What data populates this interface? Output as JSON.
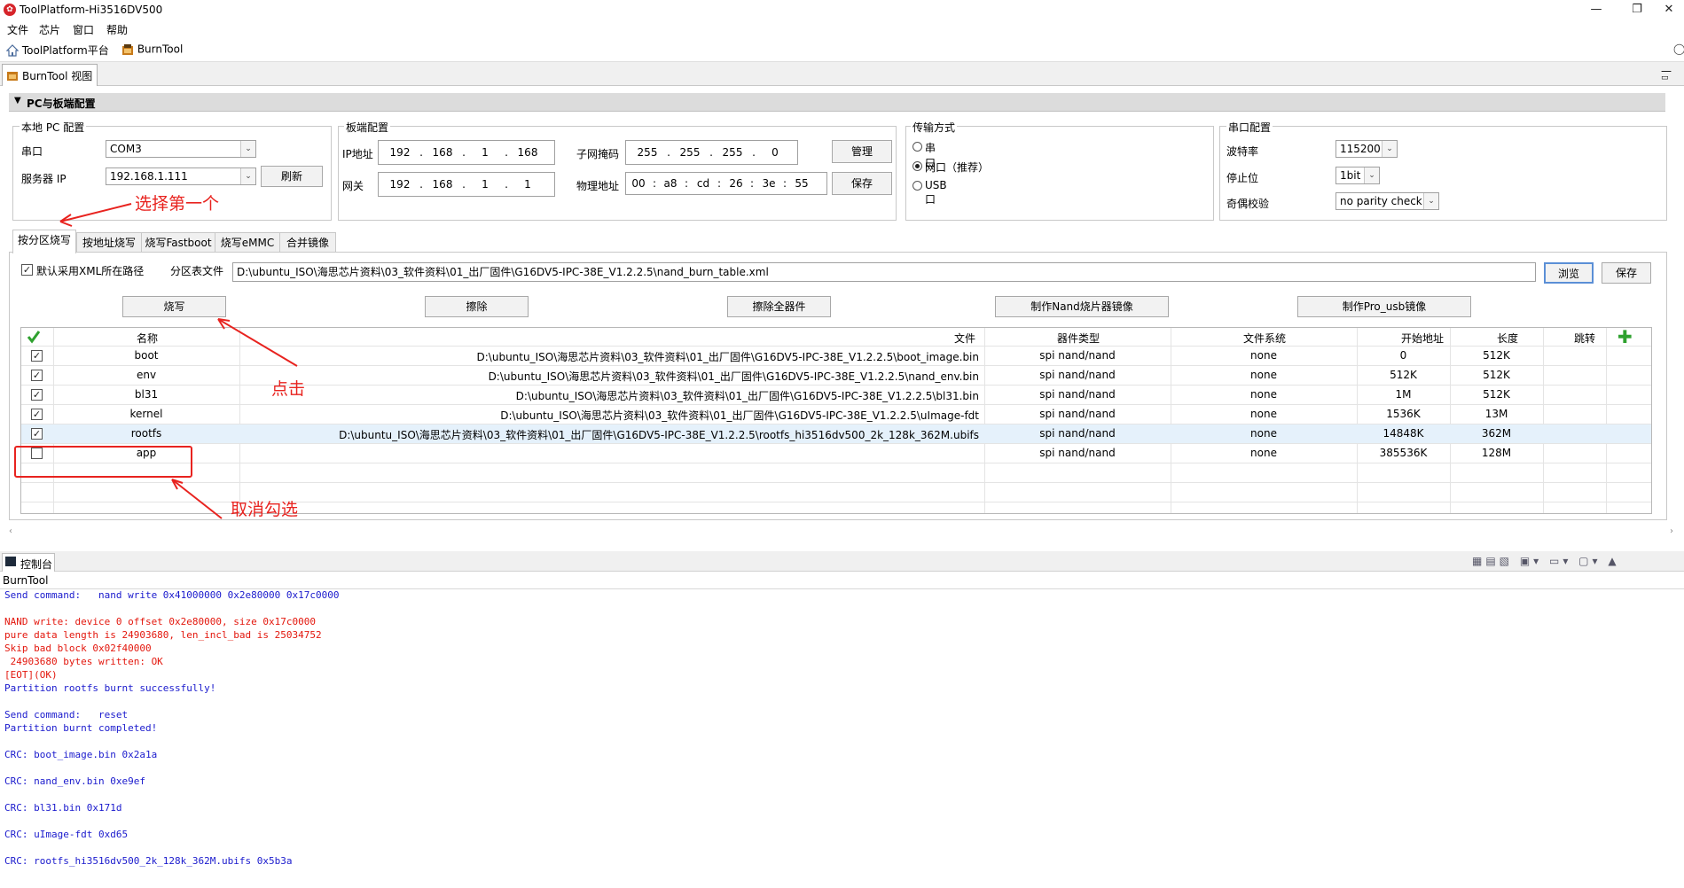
{
  "window": {
    "title": "ToolPlatform-Hi3516DV500",
    "minimize": "—",
    "restore": "❐",
    "close": "✕"
  },
  "menu": [
    "文件",
    "芯片",
    "窗口",
    "帮助"
  ],
  "toolbar": {
    "item1": "ToolPlatform平台",
    "item2": "BurnTool"
  },
  "view_tab": "BurnTool 视图",
  "section_title": "PC与板端配置",
  "local_pc": {
    "title": "本地 PC 配置",
    "port_label": "串口",
    "port_value": "COM3",
    "server_ip_label": "服务器 IP",
    "server_ip_value": "192.168.1.111",
    "refresh_btn": "刷新"
  },
  "board": {
    "title": "板端配置",
    "ip_label": "IP地址",
    "ip": [
      "192",
      "168",
      "1",
      "168"
    ],
    "gateway_label": "网关",
    "gateway": [
      "192",
      "168",
      "1",
      "1"
    ],
    "mask_label": "子网掩码",
    "mask": [
      "255",
      "255",
      "255",
      "0"
    ],
    "mac_label": "物理地址",
    "mac": [
      "00",
      "a8",
      "cd",
      "26",
      "3e",
      "55"
    ],
    "manage_btn": "管理",
    "save_btn": "保存"
  },
  "transfer": {
    "title": "传输方式",
    "opt1": "串口",
    "opt2": "网口（推荐）",
    "opt3": "USB口"
  },
  "serial": {
    "title": "串口配置",
    "baud_label": "波特率",
    "baud_value": "115200",
    "stop_label": "停止位",
    "stop_value": "1bit",
    "parity_label": "奇偶校验",
    "parity_value": "no parity check"
  },
  "tabs": [
    "按分区烧写",
    "按地址烧写",
    "烧写Fastboot",
    "烧写eMMC",
    "合并镜像"
  ],
  "partition": {
    "xml_checkbox_label": "默认采用XML所在路径",
    "table_file_label": "分区表文件",
    "table_file_path": "D:\\ubuntu_ISO\\海思芯片资料\\03_软件资料\\01_出厂固件\\G16DV5-IPC-38E_V1.2.2.5\\nand_burn_table.xml",
    "browse_btn": "浏览",
    "save_btn": "保存",
    "actions": [
      "烧写",
      "擦除",
      "擦除全器件",
      "制作Nand烧片器镜像",
      "制作Pro_usb镜像"
    ]
  },
  "table": {
    "headers": [
      "名称",
      "文件",
      "器件类型",
      "文件系统",
      "开始地址",
      "长度",
      "跳转"
    ],
    "rows": [
      {
        "checked": true,
        "name": "boot",
        "file": "D:\\ubuntu_ISO\\海思芯片资料\\03_软件资料\\01_出厂固件\\G16DV5-IPC-38E_V1.2.2.5\\boot_image.bin",
        "device": "spi nand/nand",
        "fs": "none",
        "start": "0",
        "length": "512K"
      },
      {
        "checked": true,
        "name": "env",
        "file": "D:\\ubuntu_ISO\\海思芯片资料\\03_软件资料\\01_出厂固件\\G16DV5-IPC-38E_V1.2.2.5\\nand_env.bin",
        "device": "spi nand/nand",
        "fs": "none",
        "start": "512K",
        "length": "512K"
      },
      {
        "checked": true,
        "name": "bl31",
        "file": "D:\\ubuntu_ISO\\海思芯片资料\\03_软件资料\\01_出厂固件\\G16DV5-IPC-38E_V1.2.2.5\\bl31.bin",
        "device": "spi nand/nand",
        "fs": "none",
        "start": "1M",
        "length": "512K"
      },
      {
        "checked": true,
        "name": "kernel",
        "file": "D:\\ubuntu_ISO\\海思芯片资料\\03_软件资料\\01_出厂固件\\G16DV5-IPC-38E_V1.2.2.5\\uImage-fdt",
        "device": "spi nand/nand",
        "fs": "none",
        "start": "1536K",
        "length": "13M"
      },
      {
        "checked": true,
        "name": "rootfs",
        "file": "D:\\ubuntu_ISO\\海思芯片资料\\03_软件资料\\01_出厂固件\\G16DV5-IPC-38E_V1.2.2.5\\rootfs_hi3516dv500_2k_128k_362M.ubifs",
        "device": "spi nand/nand",
        "fs": "none",
        "start": "14848K",
        "length": "362M"
      },
      {
        "checked": false,
        "name": "app",
        "file": "",
        "device": "spi nand/nand",
        "fs": "none",
        "start": "385536K",
        "length": "128M"
      }
    ]
  },
  "annotations": {
    "choose_first": "选择第一个",
    "click": "点击",
    "uncheck": "取消勾选",
    "color": "#e8231f"
  },
  "console": {
    "tab": "控制台",
    "name": "BurnTool",
    "lines": [
      {
        "c": "#1a1acd",
        "t": "Send command:   nand write 0x41000000 0x2e80000 0x17c0000"
      },
      {
        "c": "#1a1acd",
        "t": ""
      },
      {
        "c": "#e3170d",
        "t": "NAND write: device 0 offset 0x2e80000, size 0x17c0000"
      },
      {
        "c": "#e3170d",
        "t": "pure data length is 24903680, len_incl_bad is 25034752"
      },
      {
        "c": "#e3170d",
        "t": "Skip bad block 0x02f40000"
      },
      {
        "c": "#e3170d",
        "t": " 24903680 bytes written: OK"
      },
      {
        "c": "#e3170d",
        "t": "[EOT](OK)"
      },
      {
        "c": "#1a1acd",
        "t": "Partition rootfs burnt successfully!"
      },
      {
        "c": "#1a1acd",
        "t": ""
      },
      {
        "c": "#1a1acd",
        "t": "Send command:   reset"
      },
      {
        "c": "#1a1acd",
        "t": "Partition burnt completed!"
      },
      {
        "c": "#1a1acd",
        "t": ""
      },
      {
        "c": "#1a1acd",
        "t": "CRC: boot_image.bin 0x2a1a"
      },
      {
        "c": "#1a1acd",
        "t": ""
      },
      {
        "c": "#1a1acd",
        "t": "CRC: nand_env.bin 0xe9ef"
      },
      {
        "c": "#1a1acd",
        "t": ""
      },
      {
        "c": "#1a1acd",
        "t": "CRC: bl31.bin 0x171d"
      },
      {
        "c": "#1a1acd",
        "t": ""
      },
      {
        "c": "#1a1acd",
        "t": "CRC: uImage-fdt 0xd65"
      },
      {
        "c": "#1a1acd",
        "t": ""
      },
      {
        "c": "#1a1acd",
        "t": "CRC: rootfs_hi3516dv500_2k_128k_362M.ubifs 0x5b3a"
      }
    ]
  }
}
